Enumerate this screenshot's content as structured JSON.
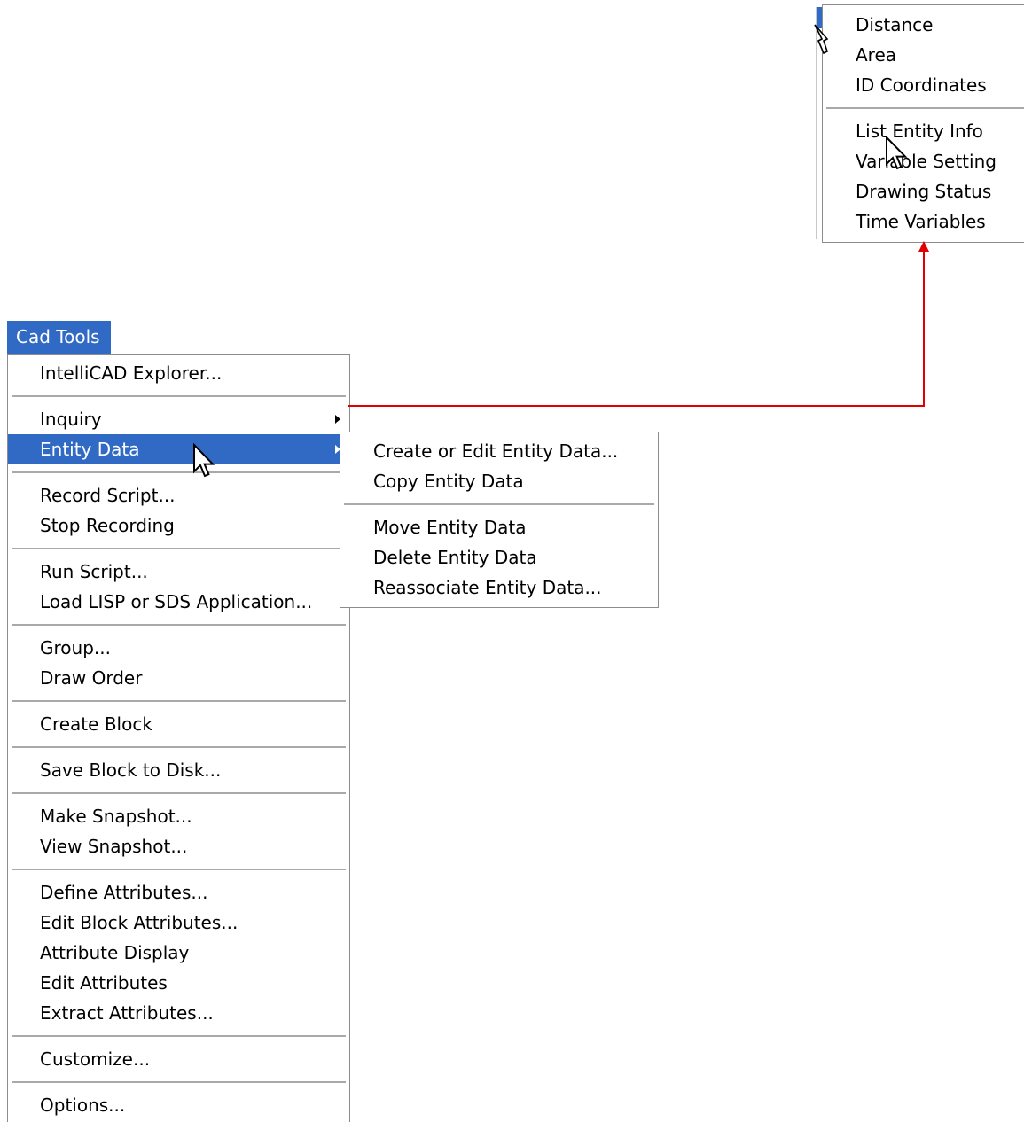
{
  "menu_bar": {
    "title": "Cad Tools"
  },
  "main_menu": {
    "items": [
      {
        "label": "IntelliCAD Explorer..."
      },
      {
        "label": "Inquiry"
      },
      {
        "label": "Entity Data"
      },
      {
        "label": "Record Script..."
      },
      {
        "label": "Stop Recording"
      },
      {
        "label": "Run Script..."
      },
      {
        "label": "Load LISP or SDS Application..."
      },
      {
        "label": "Group..."
      },
      {
        "label": "Draw Order"
      },
      {
        "label": "Create Block"
      },
      {
        "label": "Save Block to Disk..."
      },
      {
        "label": "Make Snapshot..."
      },
      {
        "label": "View Snapshot..."
      },
      {
        "label": "Define Attributes..."
      },
      {
        "label": "Edit Block Attributes..."
      },
      {
        "label": "Attribute Display"
      },
      {
        "label": "Edit Attributes"
      },
      {
        "label": "Extract Attributes..."
      },
      {
        "label": "Customize..."
      },
      {
        "label": "Options..."
      }
    ]
  },
  "entity_data_submenu": {
    "items": [
      {
        "label": "Create or Edit Entity Data..."
      },
      {
        "label": "Copy Entity Data"
      },
      {
        "label": "Move Entity Data"
      },
      {
        "label": "Delete Entity Data"
      },
      {
        "label": "Reassociate Entity Data..."
      }
    ]
  },
  "inquiry_submenu": {
    "items": [
      {
        "label": "Distance"
      },
      {
        "label": "Area"
      },
      {
        "label": "ID Coordinates"
      },
      {
        "label": "List Entity Info"
      },
      {
        "label": "Variable Setting"
      },
      {
        "label": "Drawing Status"
      },
      {
        "label": "Time Variables"
      }
    ]
  },
  "colors": {
    "highlight": "#316ac5",
    "connector": "#e00000",
    "separator": "#a9a9a9",
    "border": "#8c8c8c"
  },
  "icons": [
    "submenu-arrow-icon",
    "arrow-cursor-icon"
  ]
}
